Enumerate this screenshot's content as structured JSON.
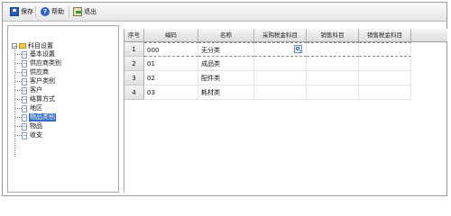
{
  "toolbar": {
    "save_label": "保存",
    "help_label": "帮助",
    "exit_label": "退出"
  },
  "tree": {
    "root_label": "科目设置",
    "items": [
      {
        "label": "基本设置"
      },
      {
        "label": "供应商类别"
      },
      {
        "label": "供应商"
      },
      {
        "label": "客户类别"
      },
      {
        "label": "客户"
      },
      {
        "label": "结算方式"
      },
      {
        "label": "地区"
      },
      {
        "label": "物品类别",
        "selected": true
      },
      {
        "label": "物品"
      },
      {
        "label": "收支"
      }
    ]
  },
  "grid": {
    "columns": [
      "序号",
      "编码",
      "名称",
      "采购税金科目",
      "销售科目",
      "销售税金科目"
    ],
    "rows": [
      {
        "no": "1",
        "code": "000",
        "name": "无分类",
        "purchase_tax": "",
        "sales": "",
        "sales_tax": ""
      },
      {
        "no": "2",
        "code": "01",
        "name": "成品类",
        "purchase_tax": "",
        "sales": "",
        "sales_tax": ""
      },
      {
        "no": "3",
        "code": "02",
        "name": "配件类",
        "purchase_tax": "",
        "sales": "",
        "sales_tax": ""
      },
      {
        "no": "4",
        "code": "03",
        "name": "耗材类",
        "purchase_tax": "",
        "sales": "",
        "sales_tax": ""
      }
    ]
  },
  "icons": {
    "save": "save-icon",
    "help": "help-icon",
    "exit": "exit-icon",
    "lookup": "search-lookup-icon"
  },
  "colors": {
    "selection": "#316ac5"
  }
}
